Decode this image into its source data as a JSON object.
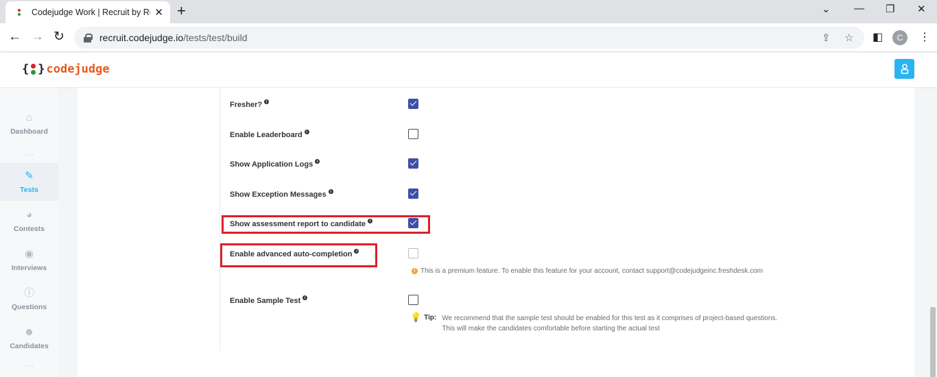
{
  "browser": {
    "tab_title": "Codejudge Work | Recruit by Rea",
    "tab_close": "✕",
    "new_tab": "+",
    "url_host": "recruit.codejudge.io",
    "url_path": "/tests/test/build",
    "profile_initial": "C"
  },
  "app": {
    "logo_open": "{",
    "logo_close": "}",
    "logo_text": "codejudge",
    "brand_color": "#e8591a",
    "accent_color": "#2ab3f3"
  },
  "sidebar": {
    "items": [
      {
        "label": "Dashboard",
        "icon": "home-icon"
      },
      {
        "label": "Tests",
        "icon": "pen-icon",
        "active": true
      },
      {
        "label": "Contests",
        "icon": "pie-chart-icon"
      },
      {
        "label": "Interviews",
        "icon": "podcast-icon"
      },
      {
        "label": "Questions",
        "icon": "question-circle-icon"
      },
      {
        "label": "Candidates",
        "icon": "users-icon"
      }
    ]
  },
  "settings": {
    "rows": [
      {
        "label": "Fresher?",
        "checked": true
      },
      {
        "label": "Enable Leaderboard",
        "checked": false
      },
      {
        "label": "Show Application Logs",
        "checked": true
      },
      {
        "label": "Show Exception Messages",
        "checked": true
      },
      {
        "label": "Show assessment report to candidate",
        "checked": true,
        "highlighted": true
      },
      {
        "label": "Enable advanced auto-completion",
        "checked": false,
        "disabled": true,
        "highlighted": true
      },
      {
        "label": "Enable Sample Test",
        "checked": false
      }
    ],
    "premium_note": "This is a premium feature. To enable this feature for your account, contact support@codejudgeinc.freshdesk.com",
    "tip_label": "Tip:",
    "tip_line1": "We recommend that the sample test should be enabled for this test as it comprises of project-based questions.",
    "tip_line2": "This will make the candidates comfortable before starting the actual test",
    "highlight_color": "#d9202a"
  }
}
